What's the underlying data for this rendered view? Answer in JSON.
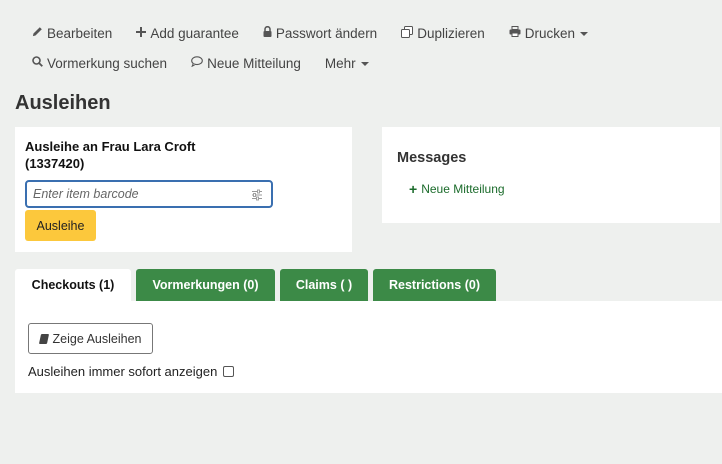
{
  "toolbar": {
    "row1": [
      {
        "label": "Bearbeiten",
        "icon": "pencil-icon"
      },
      {
        "label": "Add guarantee",
        "icon": "plus-icon"
      },
      {
        "label": "Passwort ändern",
        "icon": "lock-icon"
      },
      {
        "label": "Duplizieren",
        "icon": "copy-icon"
      },
      {
        "label": "Drucken",
        "icon": "print-icon"
      }
    ],
    "row2": [
      {
        "label": "Vormerkung suchen",
        "icon": "search-icon"
      },
      {
        "label": "Neue Mitteilung",
        "icon": "comment-icon"
      },
      {
        "label": "Mehr"
      }
    ]
  },
  "page_title": "Ausleihen",
  "checkout": {
    "heading_line1": "Ausleihe an Frau Lara Croft",
    "heading_line2": "(1337420)",
    "barcode_placeholder": "Enter item barcode",
    "submit_label": "Ausleihe",
    "submit_color": "#fcc83c"
  },
  "messages": {
    "title": "Messages",
    "new_message_label": "Neue Mitteilung",
    "link_color": "#1b6b2b"
  },
  "tabs": [
    {
      "label": "Checkouts (1)",
      "active": true
    },
    {
      "label": "Vormerkungen (0)",
      "active": false
    },
    {
      "label": "Claims ( )",
      "active": false
    },
    {
      "label": "Restrictions (0)",
      "active": false
    }
  ],
  "tab_color": "#3c8a47",
  "checkouts_panel": {
    "show_button_label": "Zeige Ausleihen",
    "always_show_label": "Ausleihen immer sofort anzeigen",
    "always_show_checked": false
  }
}
